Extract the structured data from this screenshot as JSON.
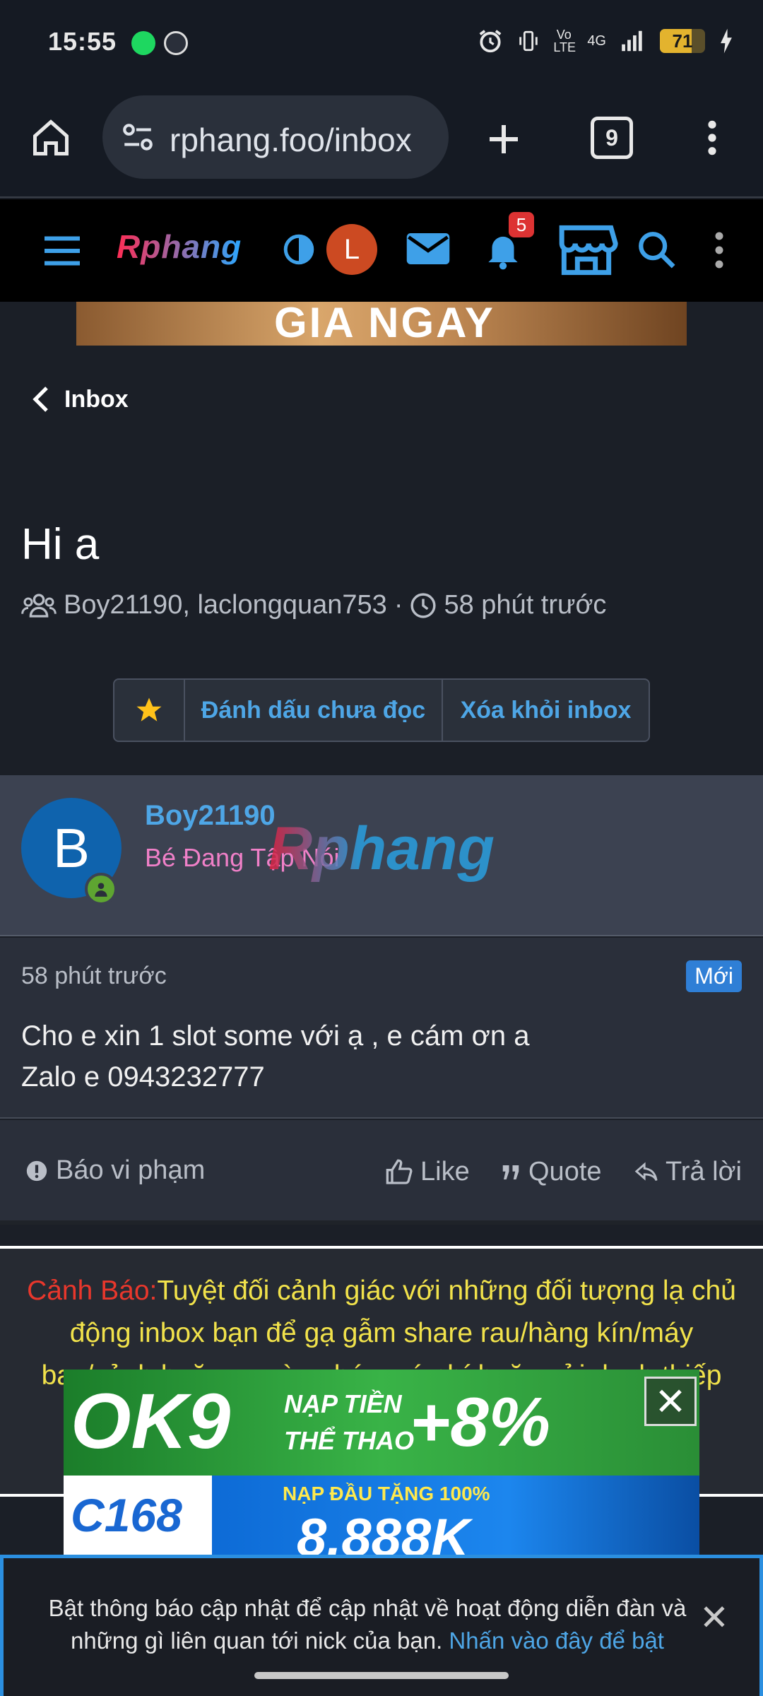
{
  "status_bar": {
    "time": "15:55",
    "network": "4G",
    "volte": "Vo LTE",
    "battery_level": "71",
    "battery_fraction": 0.71
  },
  "browser": {
    "url": "rphang.foo/inbox",
    "tab_count": "9"
  },
  "site_nav": {
    "logo": "Rphang",
    "avatar_initial": "L",
    "notification_count": "5"
  },
  "banner_top": {
    "text": "GIA NGAY"
  },
  "header": {
    "back_label": "Inbox",
    "title": "Hi a",
    "participants": "Boy21190, laclongquan753",
    "separator": "·",
    "time": "58 phút trước"
  },
  "actions": {
    "mark_unread": "Đánh dấu chưa đọc",
    "remove_inbox": "Xóa khỏi inbox"
  },
  "post": {
    "avatar_initial": "B",
    "username": "Boy21190",
    "rank": "Bé Đang Tập Nói",
    "watermark": "Rphang",
    "time": "58 phút trước",
    "badge": "Mới",
    "text_line1": "Cho e xin 1 slot some với ạ , e cám ơn a",
    "text_line2": "Zalo e 0943232777",
    "report": "Báo vi phạm",
    "like": "Like",
    "quote": "Quote",
    "reply": "Trả lời"
  },
  "warning": {
    "title": "Cảnh Báo:",
    "text": "Tuyệt đối cảnh giác với những đối tượng lạ chủ động inbox bạn để gạ gẫm share rau/hàng kín/máy bay/sảnh hoặc gạ vào nhóm có phí hoặc gửi danh thiếp"
  },
  "ads": {
    "ad1_logo": "OK9",
    "ad1_line1": "NẠP TIỀN",
    "ad1_line2": "THỂ THAO",
    "ad1_bonus": "+8%",
    "ad2_logo": "C168",
    "ad2_top": "NẠP ĐẦU TẶNG 100%",
    "ad2_amount": "8.888K"
  },
  "push_prompt": {
    "text": "Bật thông báo cập nhật để cập nhật về hoạt động diễn đàn và những gì liên quan tới nick của bạn. ",
    "link": "Nhấn vào đây để bật"
  }
}
